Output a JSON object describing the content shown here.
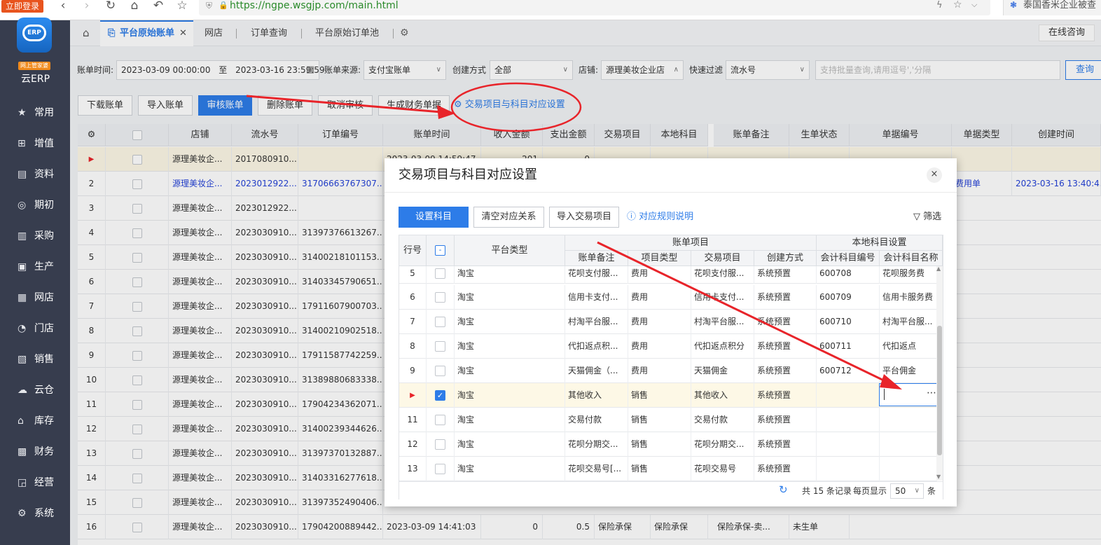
{
  "browser": {
    "login_button": "立即登录",
    "url": "https://ngpe.wsgjp.com/main.html",
    "tab_title": "泰国香米企业被查"
  },
  "sidebar": {
    "logo_tag": "网上管家婆",
    "brand": "云ERP",
    "items": [
      {
        "label": "常用",
        "icon": "star-icon"
      },
      {
        "label": "增值",
        "icon": "plus-icon"
      },
      {
        "label": "资料",
        "icon": "document-icon"
      },
      {
        "label": "期初",
        "icon": "target-icon"
      },
      {
        "label": "采购",
        "icon": "purchase-icon"
      },
      {
        "label": "生产",
        "icon": "production-icon"
      },
      {
        "label": "网店",
        "icon": "shop-icon"
      },
      {
        "label": "门店",
        "icon": "store-icon"
      },
      {
        "label": "销售",
        "icon": "sales-icon"
      },
      {
        "label": "云仓",
        "icon": "cloud-icon"
      },
      {
        "label": "库存",
        "icon": "inventory-icon"
      },
      {
        "label": "财务",
        "icon": "finance-icon"
      },
      {
        "label": "经营",
        "icon": "chart-icon"
      },
      {
        "label": "系统",
        "icon": "gear-icon"
      }
    ]
  },
  "tabs": {
    "active": "平台原始账单",
    "items": [
      "网店",
      "订单查询",
      "平台原始订单池"
    ],
    "online_consult": "在线咨询"
  },
  "filters": {
    "bill_time_label": "账单时间:",
    "start_time": "2023-03-09 00:00:00",
    "to": "至",
    "end_time": "2023-03-16 23:59:59",
    "source_label": "账单来源:",
    "source_value": "支付宝账单",
    "create_label": "创建方式",
    "create_value": "全部",
    "shop_label": "店铺:",
    "shop_value": "源理美妆企业店",
    "quick_label": "快速过滤",
    "quick_value": "流水号",
    "search_placeholder": "支持批量查询,请用逗号','分隔",
    "search_button": "查询"
  },
  "toolbar": {
    "download": "下载账单",
    "import": "导入账单",
    "audit": "审核账单",
    "delete": "删除账单",
    "cancel_audit": "取消审核",
    "generate": "生成财务单据",
    "mapping": "交易项目与科目对应设置"
  },
  "grid": {
    "headers": [
      "店铺",
      "流水号",
      "订单编号",
      "账单时间",
      "收入金额",
      "支出金额",
      "交易项目",
      "本地科目",
      "账单备注",
      "生单状态",
      "单据编号",
      "单据类型",
      "创建时间"
    ],
    "rows": [
      {
        "no": "▶",
        "shop": "源理美妆企...",
        "serial": "2017080910...",
        "order": "",
        "time": "2023-03-09 14:59:47",
        "inc": "201",
        "exp": "0",
        "item": "",
        "local": "",
        "remark": "",
        "status": "",
        "billno": "",
        "type": "",
        "ctime": ""
      },
      {
        "no": "2",
        "shop": "源理美妆企...",
        "serial": "2023012922...",
        "order": "31706663767307...",
        "time": "",
        "inc": "",
        "exp": "",
        "item": "",
        "local": "",
        "remark": "",
        "status": "",
        "billno": "",
        "type": "费用单",
        "ctime": "2023-03-16 13:40:43"
      },
      {
        "no": "3",
        "shop": "源理美妆企...",
        "serial": "2023012922...",
        "order": ""
      },
      {
        "no": "4",
        "shop": "源理美妆企...",
        "serial": "2023030910...",
        "order": "31397376613267..."
      },
      {
        "no": "5",
        "shop": "源理美妆企...",
        "serial": "2023030910...",
        "order": "31400218101153..."
      },
      {
        "no": "6",
        "shop": "源理美妆企...",
        "serial": "2023030910...",
        "order": "31403345790651..."
      },
      {
        "no": "7",
        "shop": "源理美妆企...",
        "serial": "2023030910...",
        "order": "17911607900703..."
      },
      {
        "no": "8",
        "shop": "源理美妆企...",
        "serial": "2023030910...",
        "order": "31400210902518..."
      },
      {
        "no": "9",
        "shop": "源理美妆企...",
        "serial": "2023030910...",
        "order": "17911587742259..."
      },
      {
        "no": "10",
        "shop": "源理美妆企...",
        "serial": "2023030910...",
        "order": "31389880683338..."
      },
      {
        "no": "11",
        "shop": "源理美妆企...",
        "serial": "2023030910...",
        "order": "17904234362071..."
      },
      {
        "no": "12",
        "shop": "源理美妆企...",
        "serial": "2023030910...",
        "order": "31400239344626..."
      },
      {
        "no": "13",
        "shop": "源理美妆企...",
        "serial": "2023030910...",
        "order": "31397370132887..."
      },
      {
        "no": "14",
        "shop": "源理美妆企...",
        "serial": "2023030910...",
        "order": "31403316277618..."
      },
      {
        "no": "15",
        "shop": "源理美妆企...",
        "serial": "2023030910...",
        "order": "31397352490406..."
      },
      {
        "no": "16",
        "shop": "源理美妆企...",
        "serial": "2023030910...",
        "order": "17904200889442...",
        "time": "2023-03-09 14:41:03",
        "inc": "0",
        "exp": "0.5",
        "item": "保险承保",
        "local": "保险承保",
        "remark": "保险承保-卖...",
        "status": "未生单"
      }
    ]
  },
  "dialog": {
    "title": "交易项目与科目对应设置",
    "close": "×",
    "buttons": {
      "set_subject": "设置科目",
      "clear": "清空对应关系",
      "import_items": "导入交易项目",
      "rule": "对应规则说明",
      "filter": "筛选"
    },
    "headers": {
      "row_no": "行号",
      "platform": "平台类型",
      "bill_items": "账单项目",
      "remark": "账单备注",
      "item_type": "项目类型",
      "trade_item": "交易项目",
      "create_way": "创建方式",
      "local_setting": "本地科目设置",
      "code": "会计科目编号",
      "name": "会计科目名称"
    },
    "rows": [
      {
        "no": "5",
        "checked": false,
        "platform": "淘宝",
        "remark": "花呗支付服...",
        "type": "费用",
        "item": "花呗支付服...",
        "way": "系统预置",
        "code": "600708",
        "name": "花呗服务费"
      },
      {
        "no": "6",
        "checked": false,
        "platform": "淘宝",
        "remark": "信用卡支付...",
        "type": "费用",
        "item": "信用卡支付...",
        "way": "系统预置",
        "code": "600709",
        "name": "信用卡服务费"
      },
      {
        "no": "7",
        "checked": false,
        "platform": "淘宝",
        "remark": "村淘平台服...",
        "type": "费用",
        "item": "村淘平台服...",
        "way": "系统预置",
        "code": "600710",
        "name": "村淘平台服..."
      },
      {
        "no": "8",
        "checked": false,
        "platform": "淘宝",
        "remark": "代扣返点积...",
        "type": "费用",
        "item": "代扣返点积分",
        "way": "系统预置",
        "code": "600711",
        "name": "代扣返点"
      },
      {
        "no": "9",
        "checked": false,
        "platform": "淘宝",
        "remark": "天猫佣金（...",
        "type": "费用",
        "item": "天猫佣金",
        "way": "系统预置",
        "code": "600712",
        "name": "平台佣金"
      },
      {
        "no": "▶",
        "checked": true,
        "platform": "淘宝",
        "remark": "其他收入",
        "type": "销售",
        "item": "其他收入",
        "way": "系统预置",
        "code": "",
        "name": ""
      },
      {
        "no": "11",
        "checked": false,
        "platform": "淘宝",
        "remark": "交易付款",
        "type": "销售",
        "item": "交易付款",
        "way": "系统预置",
        "code": "",
        "name": ""
      },
      {
        "no": "12",
        "checked": false,
        "platform": "淘宝",
        "remark": "花呗分期交...",
        "type": "销售",
        "item": "花呗分期交...",
        "way": "系统预置",
        "code": "",
        "name": ""
      },
      {
        "no": "13",
        "checked": false,
        "platform": "淘宝",
        "remark": "花呗交易号[...",
        "type": "销售",
        "item": "花呗交易号",
        "way": "系统预置",
        "code": "",
        "name": ""
      }
    ],
    "footer": {
      "total": "共 15 条记录",
      "per_page_label": "每页显示",
      "per_page": "50",
      "unit": "条"
    }
  },
  "colors": {
    "accent": "#2d7ce8",
    "sidebar": "#373d4e",
    "annotation": "#e8242a"
  }
}
